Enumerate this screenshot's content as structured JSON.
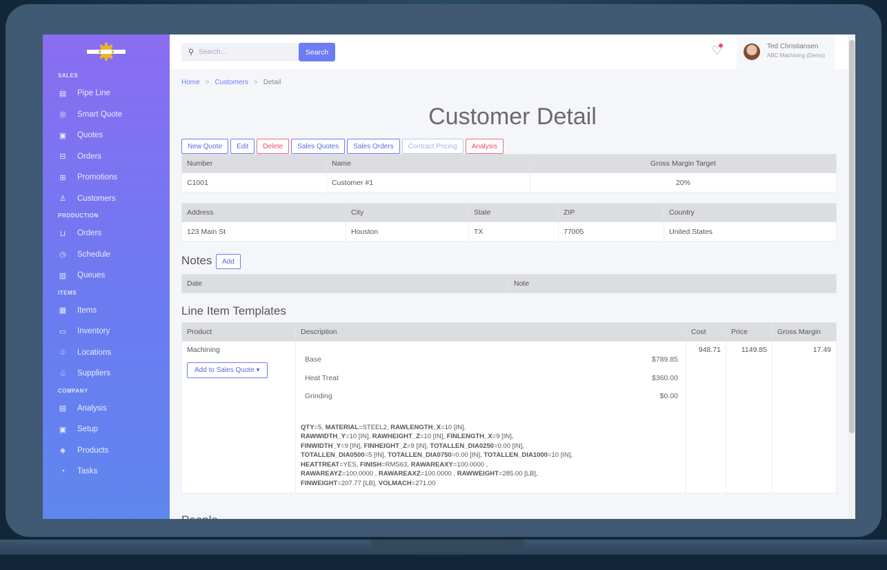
{
  "sidebar": {
    "sections": [
      {
        "label": "SALES",
        "items": [
          {
            "label": "Pipe Line",
            "icon": "pipeline-icon"
          },
          {
            "label": "Smart Quote",
            "icon": "smart-quote-icon"
          },
          {
            "label": "Quotes",
            "icon": "quotes-icon"
          },
          {
            "label": "Orders",
            "icon": "orders-icon"
          },
          {
            "label": "Promotions",
            "icon": "promotions-icon"
          },
          {
            "label": "Customers",
            "icon": "customers-icon"
          }
        ]
      },
      {
        "label": "PRODUCTION",
        "items": [
          {
            "label": "Orders",
            "icon": "cart-icon"
          },
          {
            "label": "Schedule",
            "icon": "clock-icon"
          },
          {
            "label": "Queues",
            "icon": "bar-chart-icon"
          }
        ]
      },
      {
        "label": "ITEMS",
        "items": [
          {
            "label": "Items",
            "icon": "items-icon"
          },
          {
            "label": "Inventory",
            "icon": "inventory-icon"
          },
          {
            "label": "Locations",
            "icon": "locations-icon"
          },
          {
            "label": "Suppliers",
            "icon": "suppliers-icon"
          }
        ]
      },
      {
        "label": "COMPANY",
        "items": [
          {
            "label": "Analysis",
            "icon": "analysis-icon"
          },
          {
            "label": "Setup",
            "icon": "setup-icon"
          },
          {
            "label": "Products",
            "icon": "products-icon"
          },
          {
            "label": "Tasks",
            "icon": "tasks-icon"
          }
        ]
      }
    ]
  },
  "topbar": {
    "search_placeholder": "Search...",
    "search_button": "Search",
    "user_name": "Ted Christiansen",
    "user_company": "ABC Machining (Demo)"
  },
  "breadcrumb": {
    "home": "Home",
    "customers": "Customers",
    "detail": "Detail"
  },
  "page_title": "Customer Detail",
  "actions": {
    "new_quote": "New Quote",
    "edit": "Edit",
    "delete": "Delete",
    "sales_quotes": "Sales Quotes",
    "sales_orders": "Sales Orders",
    "contract_pricing": "Contract Pricing",
    "analysis": "Analysis"
  },
  "customer": {
    "headers": {
      "number": "Number",
      "name": "Name",
      "gmt": "Gross Margin Target"
    },
    "number": "C1001",
    "name": "Customer #1",
    "gmt": "20%"
  },
  "address": {
    "headers": {
      "address": "Address",
      "city": "City",
      "state": "State",
      "zip": "ZIP",
      "country": "Country"
    },
    "address": "123 Main St",
    "city": "Houston",
    "state": "TX",
    "zip": "77005",
    "country": "United States"
  },
  "notes": {
    "title": "Notes",
    "add": "Add",
    "headers": {
      "date": "Date",
      "note": "Note"
    }
  },
  "templates": {
    "title": "Line Item Templates",
    "headers": {
      "product": "Product",
      "description": "Description",
      "cost": "Cost",
      "price": "Price",
      "gm": "Gross Margin"
    },
    "row": {
      "product": "Machining",
      "add_to_sq": "Add to Sales Quote",
      "components": [
        {
          "name": "Base",
          "value": "$789.85"
        },
        {
          "name": "Heat Treat",
          "value": "$360.00"
        },
        {
          "name": "Grinding",
          "value": "$0.00"
        }
      ],
      "cost": "948.71",
      "price": "1149.85",
      "gm": "17.49"
    }
  },
  "people": {
    "title": "People"
  }
}
